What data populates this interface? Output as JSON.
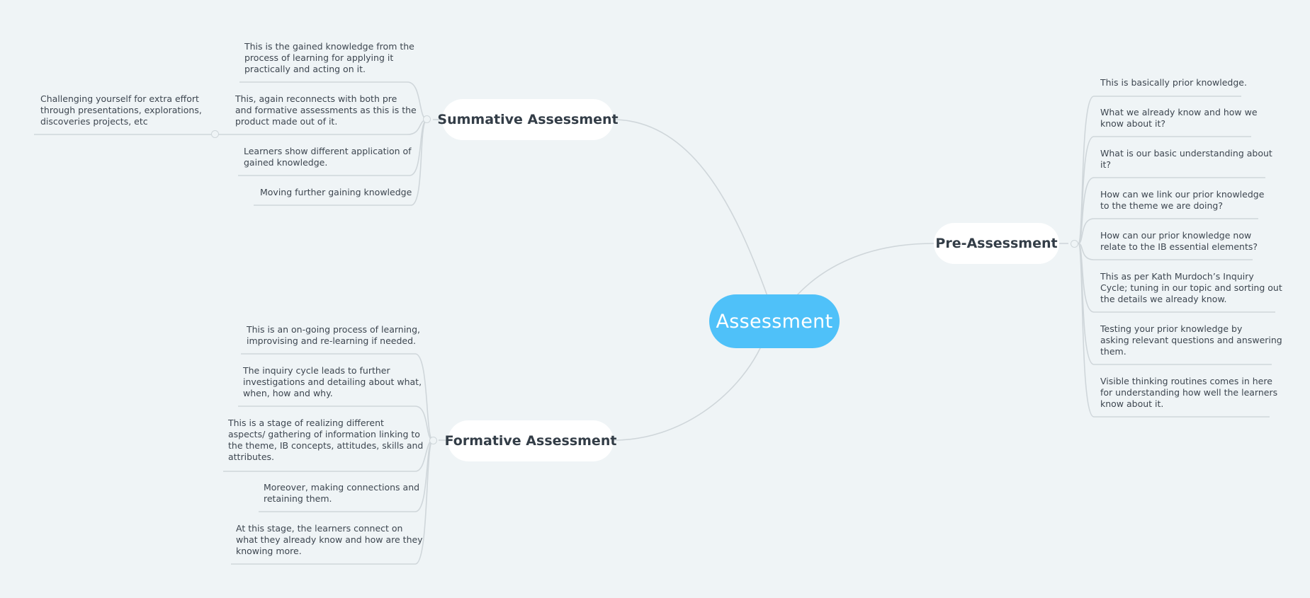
{
  "root": {
    "label": "Assessment"
  },
  "summative": {
    "label": "Summative Assessment",
    "items": [
      "This is the gained knowledge from the\nprocess of learning for applying it\npractically and acting on it.",
      "This, again reconnects with both pre\nand formative assessments as this is the\nproduct made out of it.",
      "Learners show different application of\ngained knowledge.",
      "Moving further gaining knowledge"
    ],
    "sub_item": "Challenging yourself for extra effort\nthrough presentations, explorations,\ndiscoveries projects, etc"
  },
  "formative": {
    "label": "Formative Assessment",
    "items": [
      "This is an on-going process of learning,\nimprovising and re-learning if needed.",
      "The inquiry cycle leads to further\ninvestigations and detailing about what,\nwhen, how and why.",
      "This is a stage of realizing different\naspects/ gathering of information linking to\nthe theme, IB concepts, attitudes, skills and\nattributes.",
      "Moreover, making connections and\nretaining them.",
      "At this stage, the learners connect on\nwhat they already know and how are they\nknowing more."
    ]
  },
  "pre": {
    "label": "Pre-Assessment",
    "items": [
      "This is basically prior knowledge.",
      "What we already know and how we\nknow about it?",
      "What is our basic understanding about\nit?",
      "How can we link our prior knowledge\nto the theme we are doing?",
      "How can our prior knowledge now\nrelate to the IB essential elements?",
      "This as per Kath Murdoch’s Inquiry\nCycle; tuning in our topic and sorting out\nthe details we already know.",
      "Testing your prior knowledge by\nasking relevant questions and answering\nthem.",
      "Visible thinking routines comes in here\nfor understanding how well the learners\nknow about it."
    ]
  },
  "colors": {
    "background": "#eff4f6",
    "root": "#4fc1f9",
    "line": "#cfd6da",
    "text": "#3d4650"
  }
}
